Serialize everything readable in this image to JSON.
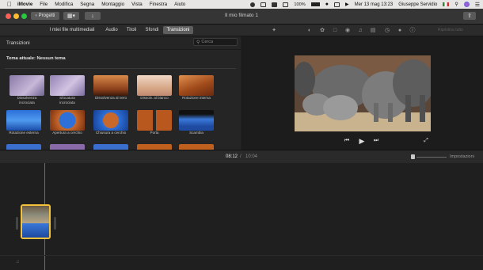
{
  "menubar": {
    "apple_icon": "apple-icon",
    "items": [
      "iMovie",
      "File",
      "Modifica",
      "Segna",
      "Montaggio",
      "Vista",
      "Finestra",
      "Aiuto"
    ],
    "battery": "100%",
    "datetime": "Mer 13 mag  13:23",
    "user": "Giuseppe Servidio"
  },
  "toolbar": {
    "back_label": "Progetti",
    "window_title": "Il mio filmato 1"
  },
  "tabs": [
    "I miei file multimediali",
    "Audio",
    "Titoli",
    "Sfondi",
    "Transizioni"
  ],
  "viewer_toolbar": {
    "reset_label": "Ripristina tutto"
  },
  "browser": {
    "section_title": "Transizioni",
    "search_placeholder": "Cerca",
    "theme_label": "Tema attuale: Nessun tema",
    "transitions": [
      [
        "Dissolvenza",
        "incrociata"
      ],
      [
        "Sfocatura",
        "incrociata"
      ],
      [
        "Dissolvenza al nero"
      ],
      [
        "Dissolv. al bianco"
      ],
      [
        "Rotazione interna"
      ],
      [
        "Rotazione esterna"
      ],
      [
        "Apertura a cerchio"
      ],
      [
        "Chiusura a cerchio"
      ],
      [
        "Porta"
      ],
      [
        "Scambia"
      ]
    ]
  },
  "timeline": {
    "current_time": "08:12",
    "separator": "/",
    "total_time": "10:04",
    "settings_label": "Impostazioni"
  },
  "colors": {
    "accent_active_tab": "#5e5e5e",
    "clip_border": "#f3c13a"
  }
}
